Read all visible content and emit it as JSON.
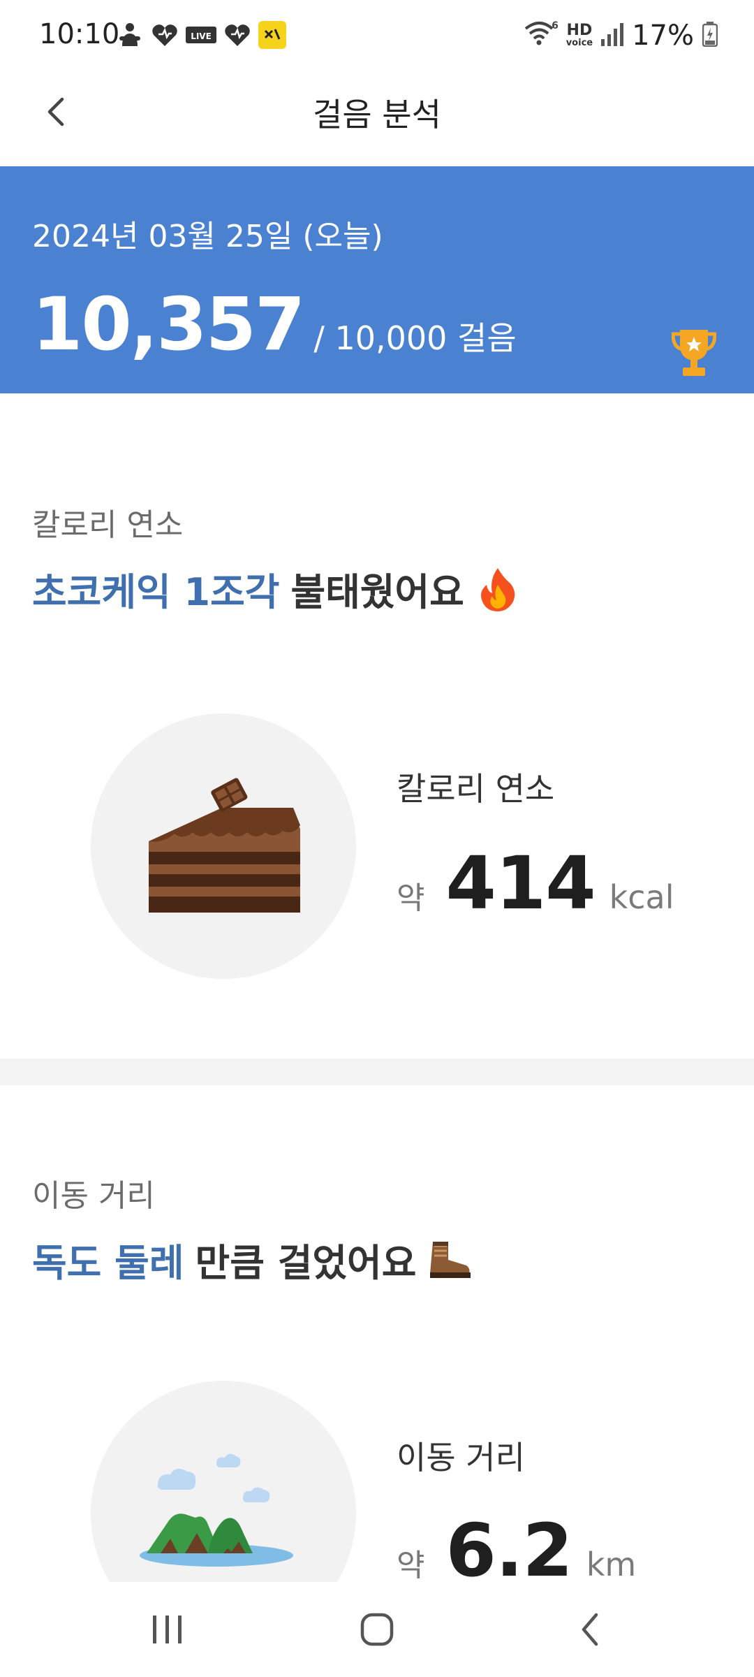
{
  "status_bar": {
    "time": "10:10",
    "left_icons": [
      "person-icon",
      "heart-bolt-icon",
      "live-badge-icon",
      "heart-bolt-icon",
      "app-badge-icon"
    ],
    "live_label": "LIVE",
    "network_label": "HD",
    "network_sub": "voice",
    "wifi_label": "6",
    "battery": "17%"
  },
  "header": {
    "title": "걸음 분석",
    "back_icon": "chevron-left-icon"
  },
  "summary": {
    "date": "2024년 03월 25일 (오늘)",
    "steps": "10,357",
    "goal": "/ 10,000 걸음",
    "trophy_icon": "trophy-icon",
    "background_color": "#4a81d1"
  },
  "calorie_section": {
    "label": "칼로리 연소",
    "headline_accent": "초코케익 1조각",
    "headline_rest": "불태웠어요",
    "headline_icon": "fire-icon",
    "illustration": "chocolate-cake-icon",
    "stat_label": "칼로리 연소",
    "approx": "약",
    "value": "414",
    "unit": "kcal"
  },
  "distance_section": {
    "label": "이동 거리",
    "headline_accent": "독도 둘레",
    "headline_rest": "만큼 걸었어요",
    "headline_icon": "hiking-boot-icon",
    "illustration": "island-icon",
    "stat_label": "이동 거리",
    "approx": "약",
    "value": "6.2",
    "unit": "km"
  },
  "nav_bar": {
    "recent_icon": "recent-apps-icon",
    "home_icon": "home-icon",
    "back_icon": "back-icon"
  },
  "colors": {
    "accent": "#3f6fae",
    "banner": "#4a81d1"
  }
}
